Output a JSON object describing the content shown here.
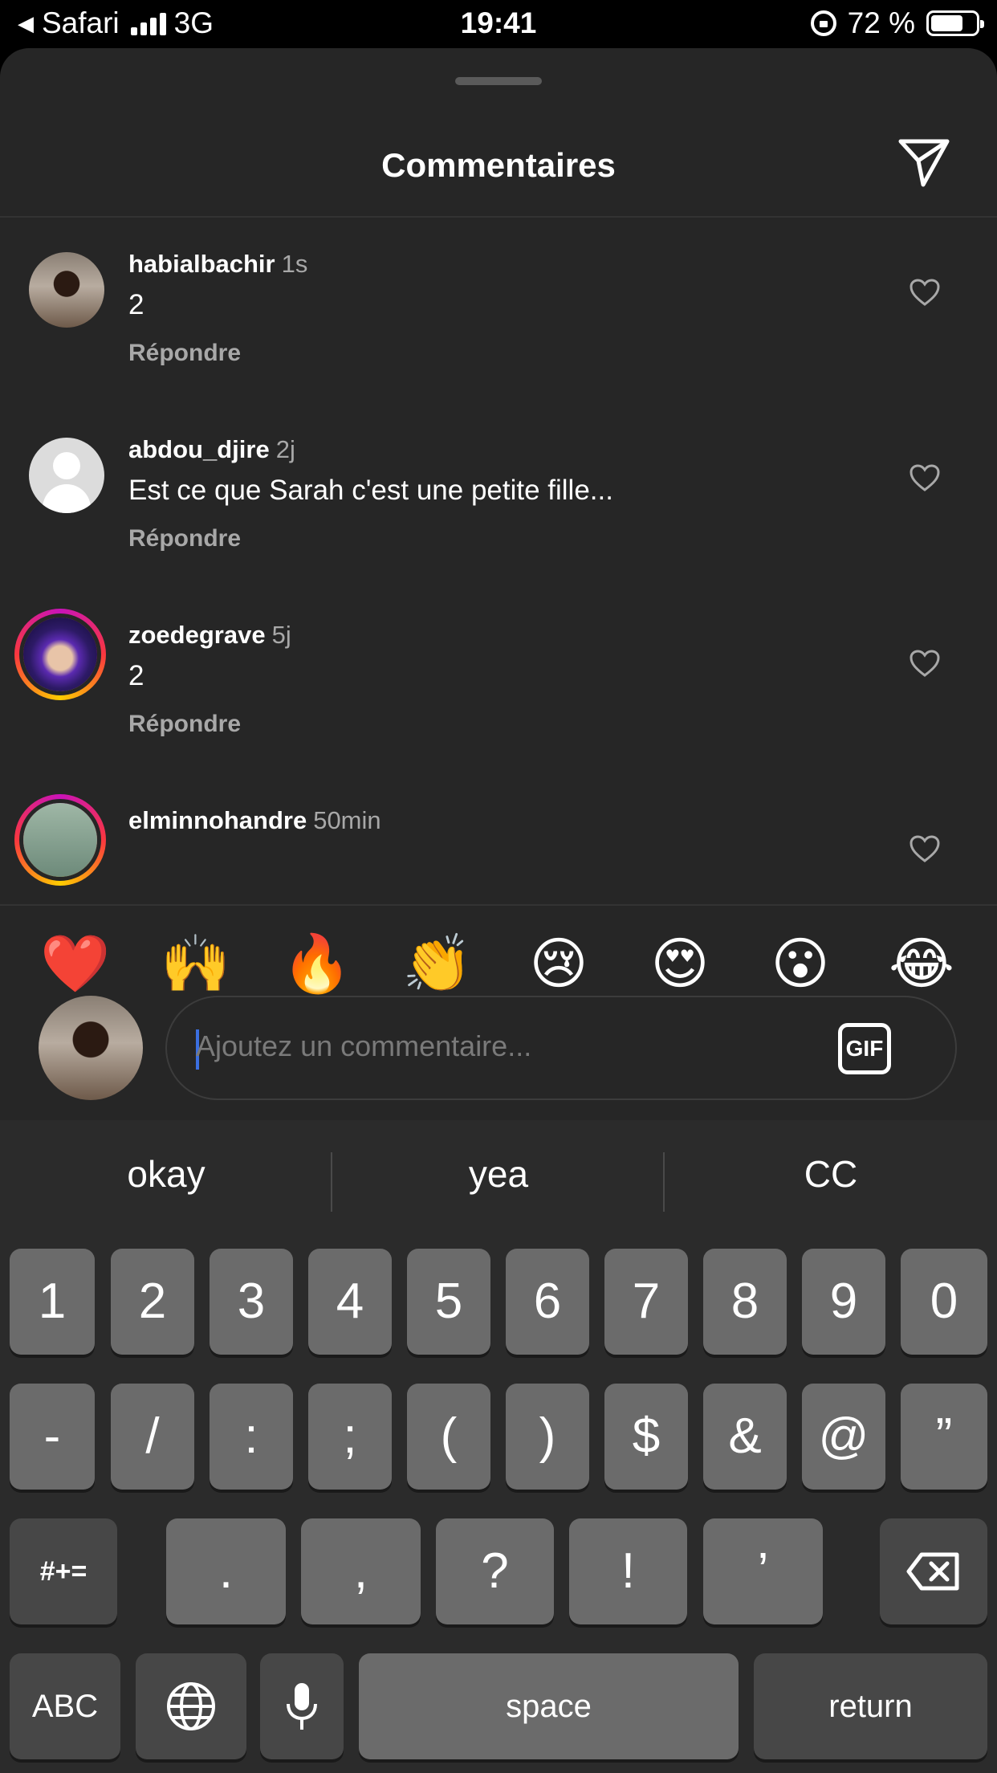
{
  "status_bar": {
    "back_label": "Safari",
    "network": "3G",
    "time": "19:41",
    "battery": "72 %",
    "battery_level": 0.72
  },
  "sheet": {
    "title": "Commentaires"
  },
  "comments": [
    {
      "user": "habialbachir",
      "time": "1s",
      "text": "2",
      "reply": "Répondre"
    },
    {
      "user": "abdou_djire",
      "time": "2j",
      "text": "Est ce que Sarah c'est une petite fille...",
      "reply": "Répondre"
    },
    {
      "user": "zoedegrave",
      "time": "5j",
      "text": "2",
      "reply": "Répondre"
    },
    {
      "user": "elminnohandre",
      "time": "50min",
      "text": "",
      "reply": ""
    }
  ],
  "reactions": [
    "❤️",
    "🙌",
    "🔥",
    "👏",
    "😢",
    "😍",
    "😮",
    "😂"
  ],
  "composer": {
    "placeholder": "Ajoutez un commentaire...",
    "gif_label": "GIF"
  },
  "keyboard": {
    "suggestions": [
      "okay",
      "yea",
      "CC"
    ],
    "row1": [
      "1",
      "2",
      "3",
      "4",
      "5",
      "6",
      "7",
      "8",
      "9",
      "0"
    ],
    "row2": [
      "-",
      "/",
      ":",
      ";",
      "(",
      ")",
      "$",
      "&",
      "@",
      "”"
    ],
    "row3": [
      ".",
      ",",
      "?",
      "!",
      "’"
    ],
    "symbols_key": "#+=",
    "abc_key": "ABC",
    "space_key": "space",
    "return_key": "return"
  }
}
